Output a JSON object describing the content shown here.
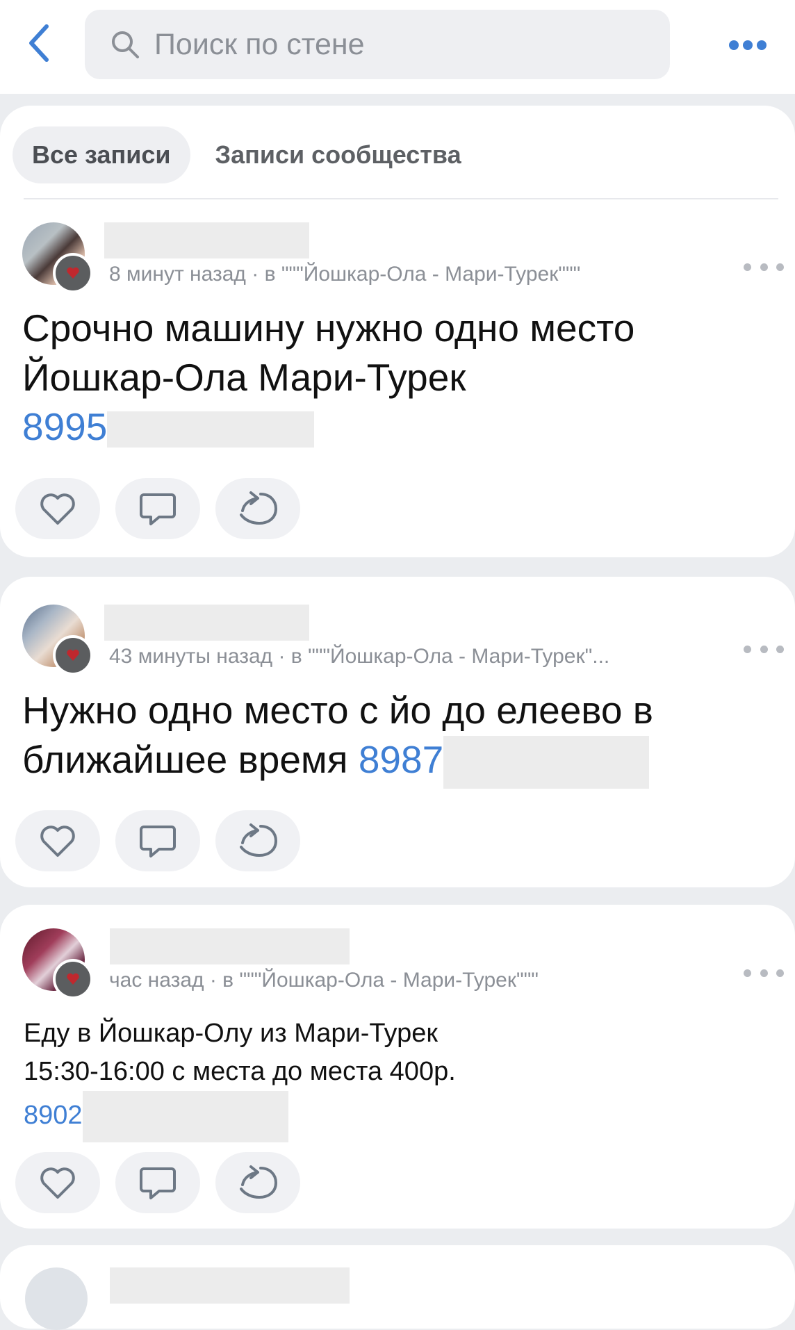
{
  "search": {
    "placeholder": "Поиск по стене"
  },
  "tabs": [
    {
      "label": "Все записи",
      "active": true
    },
    {
      "label": "Записи сообщества",
      "active": false
    }
  ],
  "posts": [
    {
      "meta": "8 минут назад · в \"\"\"Йошкар-Ола - Мари-Турек\"\"\"",
      "lines": [
        "Срочно машину нужно одно место",
        "Йошкар-Ола Мари-Турек"
      ],
      "phone": "8995"
    },
    {
      "meta": "43 минуты назад · в \"\"\"Йошкар-Ола - Мари-Турек\"...",
      "lines": [
        "Нужно одно место с йо до елеево в",
        "ближайшее время"
      ],
      "phone": "8987"
    },
    {
      "meta": "час назад · в \"\"\"Йошкар-Ола - Мари-Турек\"\"\"",
      "lines": [
        "Еду в Йошкар-Олу из Мари-Турек",
        "15:30-16:00 с места до места 400р."
      ],
      "phone": "8902"
    }
  ],
  "colors": {
    "accent": "#3f7fd4",
    "background": "#ebedf0",
    "secondary_text": "#8b8f96"
  }
}
